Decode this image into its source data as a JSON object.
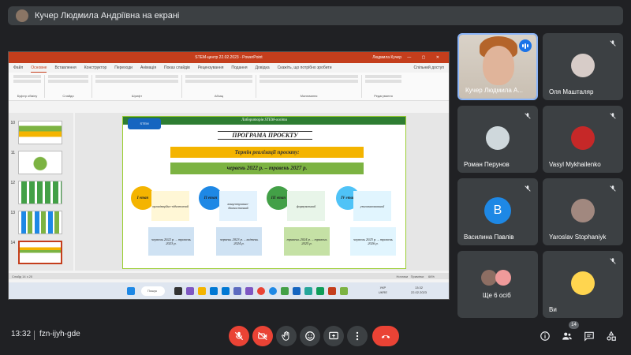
{
  "banner": {
    "text": "Кучер Людмила Андріївна на екрані"
  },
  "powerpoint": {
    "window_title": "STEM-центр 22.02.2023  -  PowerPoint",
    "user": "Людмила Кучер",
    "tabs": [
      "Файл",
      "Основне",
      "Вставлення",
      "Конструктор",
      "Переходи",
      "Анімація",
      "Показ слайдів",
      "Рецензування",
      "Подання",
      "Довідка",
      "Скажіть, що потрібно зробити"
    ],
    "share_label": "Спільний доступ",
    "ribbon_groups": [
      "Буфер обміну",
      "Слайди",
      "Шрифт",
      "Абзац",
      "Малювання",
      "Редагування"
    ],
    "thumb_numbers": [
      "10",
      "11",
      "12",
      "13",
      "14"
    ],
    "status_left": "Слайд 14 з 20",
    "status_notes": "Нотатки",
    "status_comments": "Примітки",
    "status_zoom": "66%",
    "taskbar_search": "Пошук",
    "taskbar_lang_1": "УКР",
    "taskbar_lang_2": "UKRE",
    "taskbar_time": "13:32",
    "taskbar_date": "22.02.2023"
  },
  "slide": {
    "header": "Лабораторія STEM-освіти",
    "title": "ПРОГРАМА ПРОЄКТУ",
    "term_label": "Термін реалізації проєкту:",
    "term_value": "червень 2022 р. – травень 2027 р.",
    "stages": [
      {
        "name": "I етап",
        "desc": "організаційно-підготовчий",
        "dates": "червень 2022 р. – травень 2023 р."
      },
      {
        "name": "II етап",
        "desc": "концептуально-діагностичний",
        "dates": "червень 2023 р. – квітень 2024 р."
      },
      {
        "name": "III етап",
        "desc": "формувальний",
        "dates": "травень 2024 р. – травень 2025 р."
      },
      {
        "name": "IV етап",
        "desc": "узагальнювальний",
        "dates": "червень 2025 р. – травень 2026 р."
      }
    ]
  },
  "participants": [
    {
      "name": "Кучер Людмила А...",
      "speaking": true
    },
    {
      "name": "Оля Машталяр",
      "muted": true
    },
    {
      "name": "Роман Перунов",
      "muted": true
    },
    {
      "name": "Vasyl Mykhailenko",
      "muted": true
    },
    {
      "name": "Василина Павлів",
      "muted": true,
      "letter": "B"
    },
    {
      "name": "Yaroslav Stophaniyk",
      "muted": true
    },
    {
      "name": "Ще 6 осіб"
    },
    {
      "name": "Ви",
      "muted": true
    }
  ],
  "bottom": {
    "time": "13:32",
    "meeting_code": "fzn-ijyh-gde",
    "people_count": "14"
  },
  "colors": {
    "bg": "#202124",
    "tile": "#3c4043",
    "red": "#ea4335",
    "accent": "#8ab4f8"
  }
}
